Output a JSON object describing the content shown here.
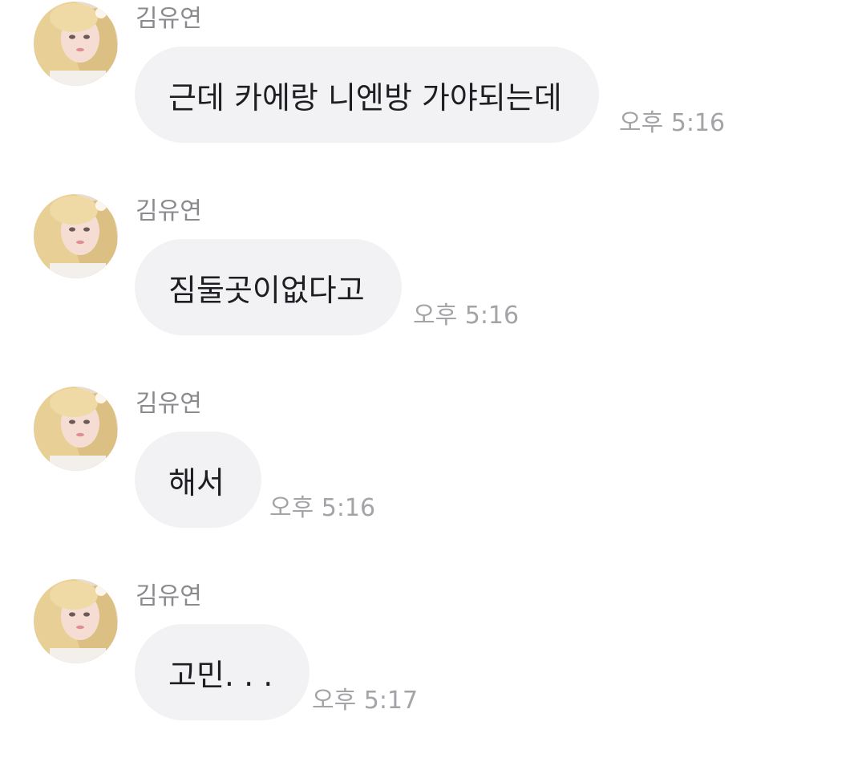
{
  "chat": {
    "messages": [
      {
        "sender": "김유연",
        "avatar_icon": "profile-photo-avatar",
        "text": "근데 카에랑 니엔방 가야되는데",
        "time": "오후 5:16"
      },
      {
        "sender": "김유연",
        "avatar_icon": "profile-photo-avatar",
        "text": "짐둘곳이없다고",
        "time": "오후 5:16"
      },
      {
        "sender": "김유연",
        "avatar_icon": "profile-photo-avatar",
        "text": "해서",
        "time": "오후 5:16"
      },
      {
        "sender": "김유연",
        "avatar_icon": "profile-photo-avatar",
        "text": "고민. . .",
        "time": "오후 5:17"
      }
    ]
  },
  "colors": {
    "background": "#ffffff",
    "bubble": "#f2f2f4",
    "sender_text": "#8a8a8f",
    "time_text": "#a3a3a8",
    "message_text": "#1e1e22"
  }
}
